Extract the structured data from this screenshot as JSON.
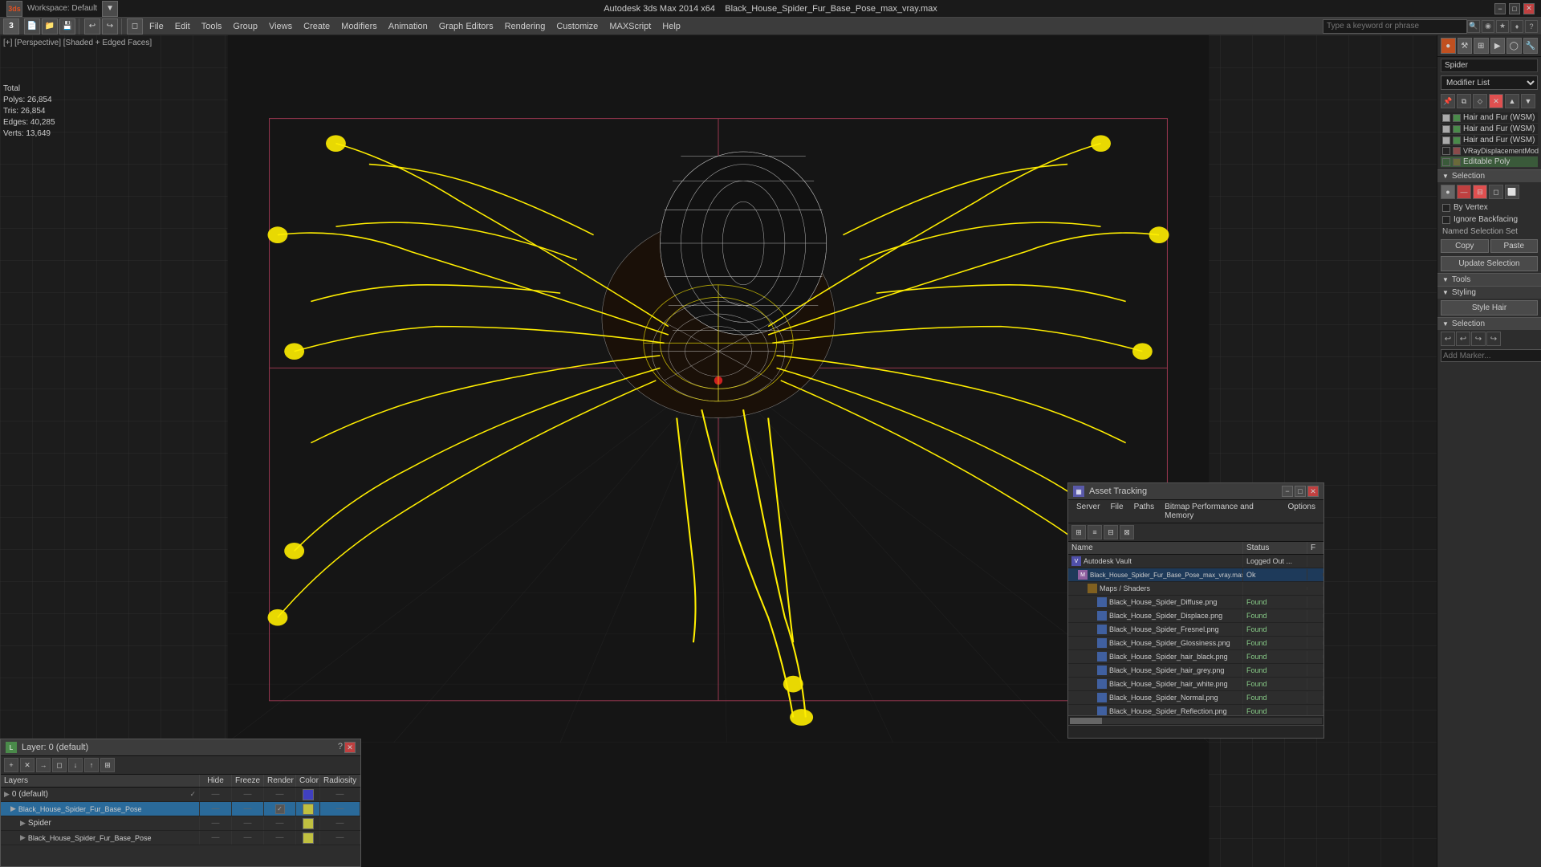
{
  "titlebar": {
    "app_title": "Autodesk 3ds Max 2014 x64",
    "file_name": "Black_House_Spider_Fur_Base_Pose_max_vray.max",
    "workspace_label": "Workspace: Default",
    "min_btn": "−",
    "max_btn": "□",
    "close_btn": "✕"
  },
  "menubar": {
    "items": [
      "File",
      "Edit",
      "Tools",
      "Group",
      "Views",
      "Create",
      "Modifiers",
      "Animation",
      "Graph Editors",
      "Rendering",
      "Customize",
      "MAXScript",
      "Help"
    ]
  },
  "search": {
    "placeholder": "Type a keyword or phrase"
  },
  "viewport": {
    "label": "[+] [Perspective] [Shaded + Edged Faces]"
  },
  "stats": {
    "polys_label": "Polys:",
    "polys_value": "26,854",
    "tris_label": "Tris:",
    "tris_value": "26,854",
    "edges_label": "Edges:",
    "edges_value": "40,285",
    "verts_label": "Verts:",
    "verts_value": "13,649",
    "total_label": "Total"
  },
  "right_panel": {
    "object_name": "Spider",
    "modifier_list_label": "Modifier List",
    "modifiers": [
      {
        "name": "Hair and Fur (WSM)",
        "checked": true
      },
      {
        "name": "Hair and Fur (WSM)",
        "checked": true
      },
      {
        "name": "Hair and Fur (WSM)",
        "checked": true
      },
      {
        "name": "VRayDisplacementMod",
        "checked": false
      },
      {
        "name": "Editable Poly",
        "checked": false,
        "active": true
      }
    ],
    "selection_label": "Selection",
    "by_vertex_label": "By Vertex",
    "ignore_backfacing_label": "Ignore Backfacing",
    "named_selection_set_label": "Named Selection Set",
    "copy_btn": "Copy",
    "paste_btn": "Paste",
    "update_selection_btn": "Update Selection",
    "tools_label": "Tools",
    "styling_label": "Styling",
    "style_hair_btn": "Style Hair",
    "selection2_label": "Selection",
    "marker_placeholder": "Add Marker..."
  },
  "asset_tracking": {
    "title": "Asset Tracking",
    "minimize_btn": "−",
    "restore_btn": "□",
    "close_btn": "✕",
    "menu_items": [
      "Server",
      "File",
      "Paths",
      "Bitmap Performance and Memory",
      "Options"
    ],
    "columns": {
      "name": "Name",
      "status": "Status",
      "flag": "F"
    },
    "rows": [
      {
        "indent": 0,
        "name": "Autodesk Vault",
        "status": "Logged Out ...",
        "type": "vault"
      },
      {
        "indent": 1,
        "name": "Black_House_Spider_Fur_Base_Pose_max_vray.max",
        "status": "Ok",
        "type": "file"
      },
      {
        "indent": 2,
        "name": "Maps / Shaders",
        "status": "",
        "type": "folder"
      },
      {
        "indent": 3,
        "name": "Black_House_Spider_Diffuse.png",
        "status": "Found",
        "type": "image"
      },
      {
        "indent": 3,
        "name": "Black_House_Spider_Displace.png",
        "status": "Found",
        "type": "image"
      },
      {
        "indent": 3,
        "name": "Black_House_Spider_Fresnel.png",
        "status": "Found",
        "type": "image"
      },
      {
        "indent": 3,
        "name": "Black_House_Spider_Glossiness.png",
        "status": "Found",
        "type": "image"
      },
      {
        "indent": 3,
        "name": "Black_House_Spider_hair_black.png",
        "status": "Found",
        "type": "image"
      },
      {
        "indent": 3,
        "name": "Black_House_Spider_hair_grey.png",
        "status": "Found",
        "type": "image"
      },
      {
        "indent": 3,
        "name": "Black_House_Spider_hair_white.png",
        "status": "Found",
        "type": "image"
      },
      {
        "indent": 3,
        "name": "Black_House_Spider_Normal.png",
        "status": "Found",
        "type": "image"
      },
      {
        "indent": 3,
        "name": "Black_House_Spider_Reflection.png",
        "status": "Found",
        "type": "image"
      }
    ]
  },
  "layers": {
    "title": "Layer: 0 (default)",
    "close_btn": "✕",
    "question_btn": "?",
    "columns": {
      "layers": "Layers",
      "hide": "Hide",
      "freeze": "Freeze",
      "render": "Render",
      "color": "Color",
      "radiosity": "Radiosity"
    },
    "rows": [
      {
        "indent": 0,
        "name": "0 (default)",
        "hide": true,
        "freeze": true,
        "render": true,
        "color": "blue"
      },
      {
        "indent": 1,
        "name": "Black_House_Spider_Fur_Base_Pose",
        "selected": true,
        "hide": false,
        "freeze": false,
        "render": true,
        "color": "yellow"
      },
      {
        "indent": 2,
        "name": "Spider",
        "hide": false,
        "freeze": false,
        "render": false,
        "color": "yellow"
      },
      {
        "indent": 2,
        "name": "Black_House_Spider_Fur_Base_Pose",
        "hide": false,
        "freeze": false,
        "render": false,
        "color": "yellow"
      }
    ]
  }
}
